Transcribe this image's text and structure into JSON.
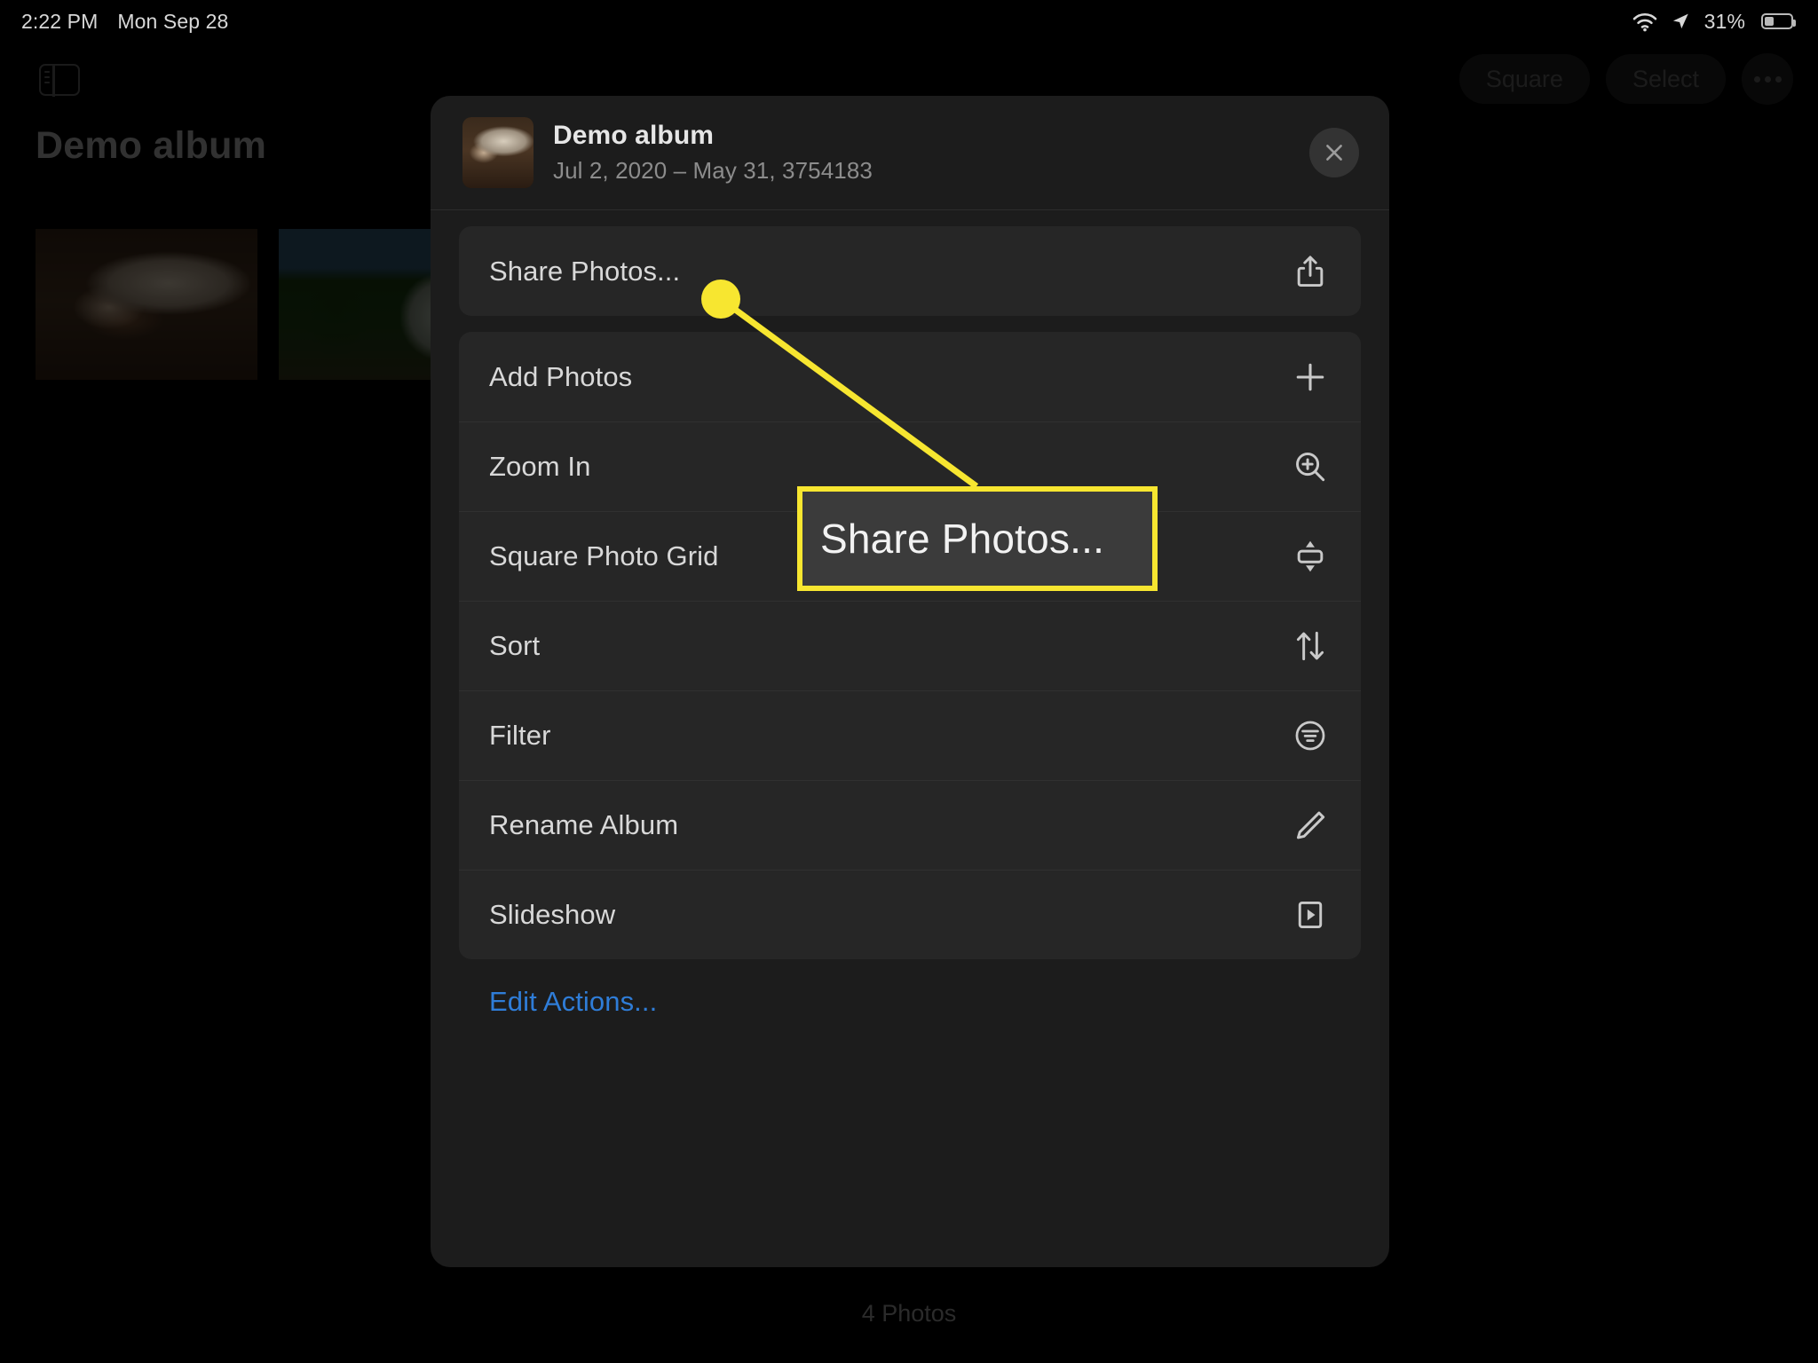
{
  "statusbar": {
    "time": "2:22 PM",
    "date": "Mon Sep 28",
    "wifi_icon": "wifi-icon",
    "location_icon": "location-arrow-icon",
    "battery_percent": "31%",
    "battery_level": 31,
    "battery_icon": "battery-icon"
  },
  "app": {
    "sidebar_toggle_icon": "sidebar-toggle-icon",
    "album_title": "Demo album",
    "photos_count": "4 Photos",
    "toolbar": {
      "square_label": "Square",
      "select_label": "Select",
      "more_icon": "ellipsis-icon"
    },
    "thumbnails": [
      {
        "name": "sleeping-dog-photo"
      },
      {
        "name": "white-house-photo"
      },
      {
        "name": "photo-three"
      },
      {
        "name": "photo-four"
      }
    ]
  },
  "sheet": {
    "title": "Demo album",
    "subtitle": "Jul 2, 2020 – May 31, 3754183",
    "thumbnail_name": "album-cover-thumbnail",
    "close_icon": "close-icon",
    "groups": [
      {
        "items": [
          {
            "label": "Share Photos...",
            "icon": "share-icon"
          }
        ]
      },
      {
        "items": [
          {
            "label": "Add Photos",
            "icon": "plus-icon"
          },
          {
            "label": "Zoom In",
            "icon": "magnifier-plus-icon"
          },
          {
            "label": "Square Photo Grid",
            "icon": "aspect-ratio-icon"
          },
          {
            "label": "Sort",
            "icon": "sort-arrows-icon"
          },
          {
            "label": "Filter",
            "icon": "filter-icon"
          },
          {
            "label": "Rename Album",
            "icon": "pencil-icon"
          },
          {
            "label": "Slideshow",
            "icon": "play-box-icon"
          }
        ]
      }
    ],
    "edit_actions_label": "Edit Actions..."
  },
  "annotation": {
    "callout_text": "Share Photos...",
    "highlight_color": "#F7E630",
    "target": "Share Photos..."
  }
}
